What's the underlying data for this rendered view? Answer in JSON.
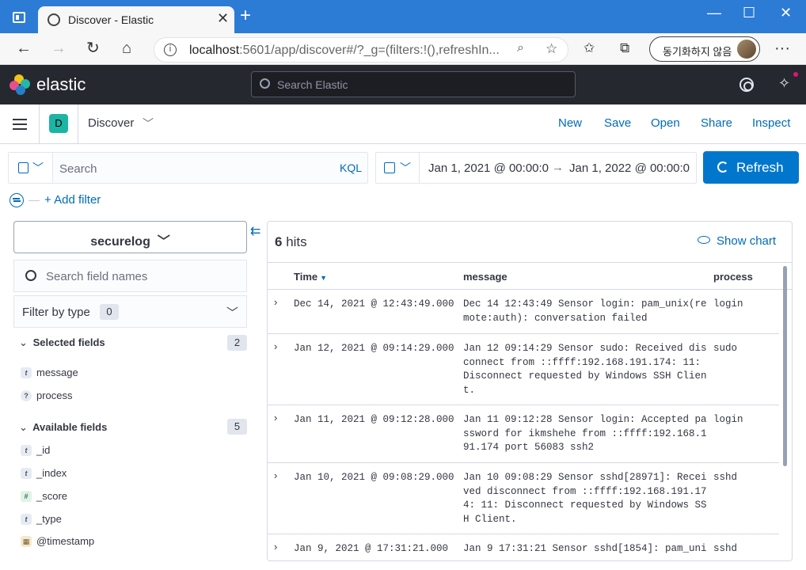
{
  "browser": {
    "tab_title": "Discover - Elastic",
    "tab_close": "✕",
    "new_tab": "+",
    "url_host": "localhost",
    "url_rest": ":5601/app/discover#/?_g=(filters:!(),refreshIn...",
    "sync_label": "동기화하지 않음",
    "min": "—",
    "max": "☐",
    "close": "✕",
    "back": "←",
    "forward": "→",
    "reload": "↻",
    "home": "⌂",
    "more": "···"
  },
  "header": {
    "brand": "elastic",
    "search_placeholder": "Search Elastic"
  },
  "appbar": {
    "space_initial": "D",
    "breadcrumb": "Discover",
    "nav": [
      "New",
      "Save",
      "Open",
      "Share",
      "Inspect"
    ]
  },
  "query": {
    "placeholder": "Search",
    "language": "KQL"
  },
  "date": {
    "start": "Jan 1, 2021 @ 00:00:0",
    "end": "Jan 1, 2022 @ 00:00:0",
    "arrow": "→"
  },
  "refresh_label": "Refresh",
  "add_filter": "+ Add filter",
  "sidebar": {
    "index_pattern": "securelog",
    "field_search_placeholder": "Search field names",
    "filter_by_type": "Filter by type",
    "filter_count": "0",
    "selected_title": "Selected fields",
    "selected_count": "2",
    "selected": [
      {
        "token": "t",
        "name": "message"
      },
      {
        "token": "?",
        "name": "process"
      }
    ],
    "available_title": "Available fields",
    "available_count": "5",
    "available": [
      {
        "token": "t",
        "name": "_id"
      },
      {
        "token": "t",
        "name": "_index"
      },
      {
        "token": "#",
        "name": "_score"
      },
      {
        "token": "t",
        "name": "_type"
      },
      {
        "token": "▦",
        "name": "@timestamp"
      }
    ]
  },
  "results": {
    "hits_count": "6",
    "hits_label": "hits",
    "show_chart": "Show chart",
    "columns": [
      "Time",
      "message",
      "process"
    ],
    "rows": [
      {
        "time": "Dec 14, 2021 @ 12:43:49.000",
        "message": "Dec 14 12:43:49 Sensor login: pam_unix(re\nmote:auth): conversation failed",
        "process": "login"
      },
      {
        "time": "Jan 12, 2021 @ 09:14:29.000",
        "message": "Jan 12 09:14:29 Sensor sudo: Received dis\nconnect from ::ffff:192.168.191.174: 11:\nDisconnect requested by Windows SSH Clien\nt.",
        "process": "sudo"
      },
      {
        "time": "Jan 11, 2021 @ 09:12:28.000",
        "message": "Jan 11 09:12:28 Sensor login: Accepted pa\nssword for ikmshehe from ::ffff:192.168.1\n91.174 port 56083 ssh2",
        "process": "login"
      },
      {
        "time": "Jan 10, 2021 @ 09:08:29.000",
        "message": "Jan 10 09:08:29 Sensor sshd[28971]: Recei\nved disconnect from ::ffff:192.168.191.17\n4: 11: Disconnect requested by Windows SS\nH Client.",
        "process": "sshd"
      },
      {
        "time": "Jan 9, 2021 @ 17:31:21.000",
        "message": "Jan 9 17:31:21 Sensor sshd[1854]: pam_uni",
        "process": "sshd"
      }
    ]
  }
}
